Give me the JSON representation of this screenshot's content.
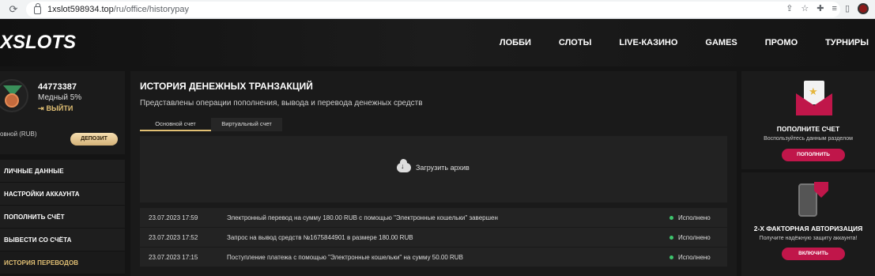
{
  "browser": {
    "url_domain": "1xslot598934.top",
    "url_path": "/ru/office/historypay"
  },
  "header": {
    "logo": "XSLOTS",
    "nav": [
      "ЛОББИ",
      "СЛОТЫ",
      "LIVE-КАЗИНО",
      "GAMES",
      "ПРОМО",
      "ТУРНИРЫ"
    ]
  },
  "profile": {
    "user_id": "44773387",
    "level": "Медный 5%",
    "logout": "ВЫЙТИ",
    "balance_label": "овной (RUB)",
    "deposit_button": "ДЕПОЗИТ"
  },
  "side_menu": [
    "ЛИЧНЫЕ ДАННЫЕ",
    "НАСТРОЙКИ АККАУНТА",
    "ПОПОЛНИТЬ СЧЁТ",
    "ВЫВЕСТИ СО СЧЁТА",
    "ИСТОРИЯ ПЕРЕВОДОВ"
  ],
  "main": {
    "title": "ИСТОРИЯ ДЕНЕЖНЫХ ТРАНЗАКЦИЙ",
    "subtitle": "Представлены операции пополнения, вывода и перевода денежных средств",
    "tabs": [
      "Основной счет",
      "Виртуальный счет"
    ],
    "archive_label": "Загрузить архив",
    "transactions": [
      {
        "date": "23.07.2023 17:59",
        "description": "Электронный перевод на сумму 180.00 RUB с помощью \"Электронные кошельки\" завершен",
        "status": "Исполнено"
      },
      {
        "date": "23.07.2023 17:52",
        "description": "Запрос на вывод средств №1675844901 в размере 180.00 RUB",
        "status": "Исполнено"
      },
      {
        "date": "23.07.2023 17:15",
        "description": "Поступление платежа с помощью \"Электронные кошельки\" на сумму 50.00 RUB",
        "status": "Исполнено"
      }
    ]
  },
  "right": {
    "topup_title": "ПОПОЛНИТЕ СЧЕТ",
    "topup_sub": "Воспользуйтесь данным разделом",
    "topup_button": "ПОПОЛНИТЬ",
    "twofa_title": "2-Х ФАКТОРНАЯ АВТОРИЗАЦИЯ",
    "twofa_sub": "Получите надёжную защиту аккаунта!",
    "twofa_button": "ВКЛЮЧИТЬ"
  }
}
